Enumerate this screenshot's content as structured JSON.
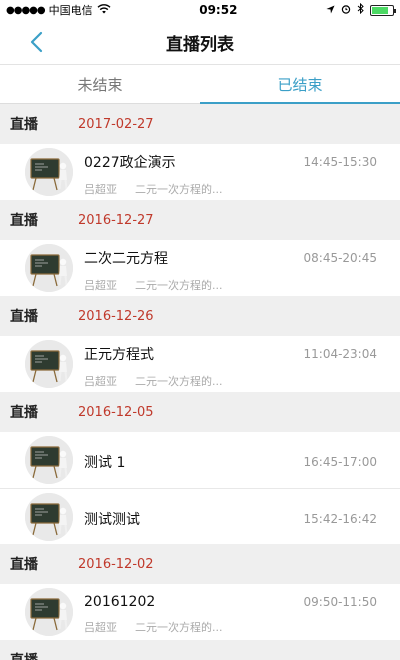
{
  "status_bar": {
    "carrier": "中国电信",
    "time": "09:52",
    "colors": {
      "battery": "#4cd964"
    }
  },
  "nav": {
    "title": "直播列表"
  },
  "tabs": [
    {
      "label": "未结束",
      "active": false
    },
    {
      "label": "已结束",
      "active": true
    }
  ],
  "colors": {
    "accent": "#3b9fc7",
    "date": "#c0392b"
  },
  "sections": [
    {
      "type": "直播",
      "date": "2017-02-27",
      "items": [
        {
          "title": "0227政企演示",
          "time": "14:45-15:30",
          "teacher": "吕超亚",
          "desc": "二元一次方程的..."
        }
      ]
    },
    {
      "type": "直播",
      "date": "2016-12-27",
      "items": [
        {
          "title": "二次二元方程",
          "time": "08:45-20:45",
          "teacher": "吕超亚",
          "desc": "二元一次方程的..."
        }
      ]
    },
    {
      "type": "直播",
      "date": "2016-12-26",
      "items": [
        {
          "title": "正元方程式",
          "time": "11:04-23:04",
          "teacher": "吕超亚",
          "desc": "二元一次方程的..."
        }
      ]
    },
    {
      "type": "直播",
      "date": "2016-12-05",
      "items": [
        {
          "title": "测试 1",
          "time": "16:45-17:00",
          "teacher": "",
          "desc": ""
        },
        {
          "title": "测试测试",
          "time": "15:42-16:42",
          "teacher": "",
          "desc": ""
        }
      ]
    },
    {
      "type": "直播",
      "date": "2016-12-02",
      "items": [
        {
          "title": "20161202",
          "time": "09:50-11:50",
          "teacher": "吕超亚",
          "desc": "二元一次方程的..."
        }
      ]
    },
    {
      "type": "直播",
      "date": "",
      "items": []
    }
  ]
}
